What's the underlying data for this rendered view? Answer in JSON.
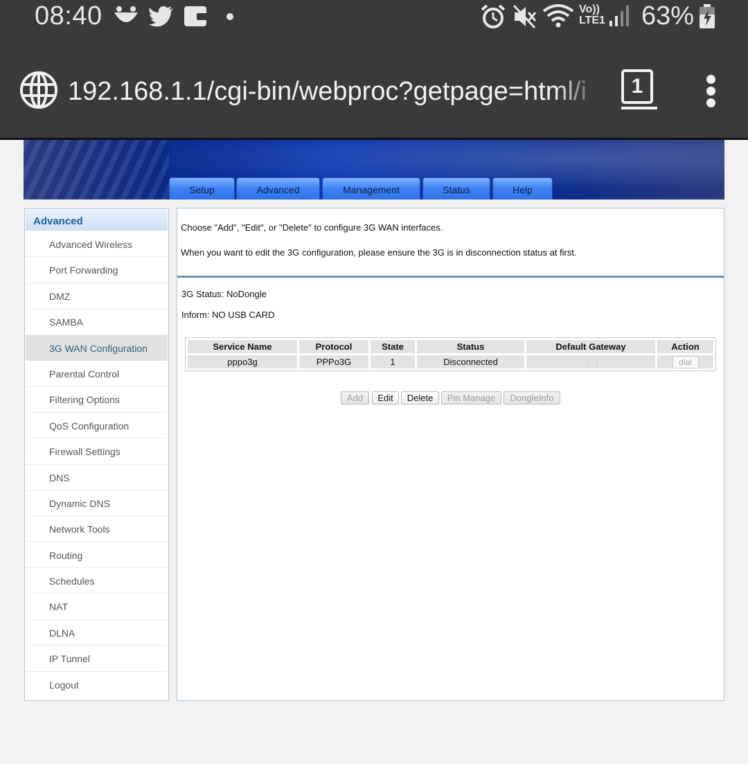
{
  "status_bar": {
    "time": "08:40",
    "network": "LTE1",
    "battery_percent": "63%"
  },
  "browser": {
    "url": "192.168.1.1/cgi-bin/webproc?getpage=html/i",
    "tab_count": "1"
  },
  "top_nav": {
    "tabs": [
      "Setup",
      "Advanced",
      "Management",
      "Status",
      "Help"
    ],
    "active": "Advanced"
  },
  "sidebar": {
    "title": "Advanced",
    "items": [
      "Advanced Wireless",
      "Port Forwarding",
      "DMZ",
      "SAMBA",
      "3G WAN Configuration",
      "Parental Control",
      "Filtering Options",
      "QoS Configuration",
      "Firewall Settings",
      "DNS",
      "Dynamic DNS",
      "Network Tools",
      "Routing",
      "Schedules",
      "NAT",
      "DLNA",
      "IP Tunnel",
      "Logout"
    ],
    "active": "3G WAN Configuration"
  },
  "content": {
    "intro1": "Choose \"Add\", \"Edit\", or \"Delete\" to configure 3G WAN interfaces.",
    "intro2": "When you want to edit the 3G configuration, please ensure the 3G is in disconnection status at first.",
    "status_3g": "3G Status: NoDongle",
    "inform": "Inform: NO USB CARD",
    "table": {
      "columns": [
        "Service Name",
        "Protocol",
        "State",
        "Status",
        "Default Gateway",
        "Action"
      ],
      "rows": [
        {
          "service_name": "pppo3g",
          "protocol": "PPPo3G",
          "state": "1",
          "status": "Disconnected",
          "default_gateway": "",
          "action": "dial"
        }
      ]
    },
    "buttons": {
      "add": "Add",
      "edit": "Edit",
      "delete": "Delete",
      "pin_manage": "Pin Manage",
      "dongle_info": "DongleInfo"
    }
  }
}
